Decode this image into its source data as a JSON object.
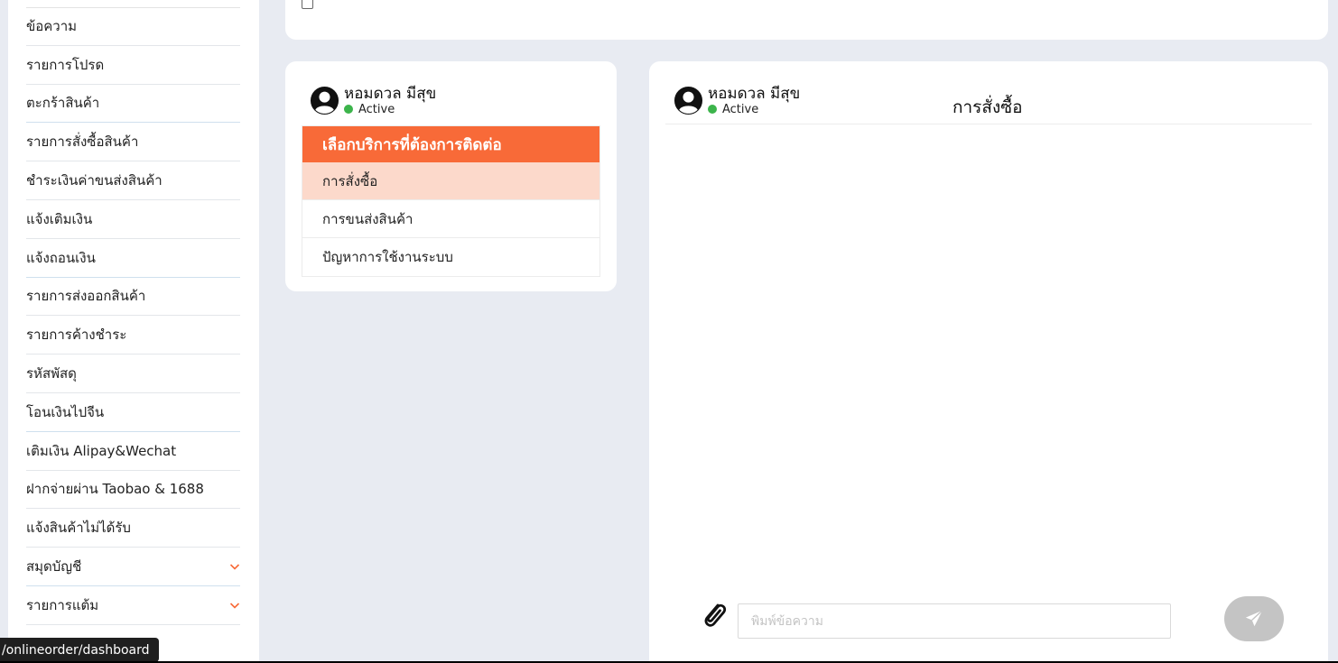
{
  "sidebar": {
    "items": [
      {
        "label": "ข้อความ",
        "expandable": false
      },
      {
        "label": "รายการโปรด",
        "expandable": false
      },
      {
        "label": "ตะกร้าสินค้า",
        "expandable": false
      },
      {
        "label": "รายการสั่งซื้อสินค้า",
        "expandable": false
      },
      {
        "label": "ชำระเงินค่าขนส่งสินค้า",
        "expandable": false
      },
      {
        "label": "แจ้งเติมเงิน",
        "expandable": false
      },
      {
        "label": "แจ้งถอนเงิน",
        "expandable": false
      },
      {
        "label": "รายการส่งออกสินค้า",
        "expandable": false
      },
      {
        "label": "รายการค้างชำระ",
        "expandable": false
      },
      {
        "label": "รหัสพัสดุ",
        "expandable": false
      },
      {
        "label": "โอนเงินไปจีน",
        "expandable": false
      },
      {
        "label": "เติมเงิน Alipay&Wechat",
        "expandable": false
      },
      {
        "label": "ฝากจ่ายผ่าน Taobao & 1688",
        "expandable": false
      },
      {
        "label": "แจ้งสินค้าไม่ได้รับ",
        "expandable": false
      },
      {
        "label": "สมุดบัญชี",
        "expandable": true
      },
      {
        "label": "รายการแต้ม",
        "expandable": true
      }
    ]
  },
  "user": {
    "name": "หอมดวล มีสุข",
    "status": "Active",
    "status_color": "#3cb44b"
  },
  "service_menu": {
    "header": "เลือกบริการที่ต้องการติดต่อ",
    "items": [
      {
        "label": "การสั่งซื้อ",
        "active": true
      },
      {
        "label": "การขนส่งสินค้า",
        "active": false
      },
      {
        "label": "ปัญหาการใช้งานระบบ",
        "active": false
      }
    ]
  },
  "chat": {
    "title": "การสั่งซื้อ",
    "input_placeholder": "พิมพ์ข้อความ",
    "input_value": ""
  },
  "status_bar": {
    "url": "/onlineorder/dashboard"
  },
  "colors": {
    "accent": "#f86a38",
    "active_item_bg": "#fcd9cb",
    "send_button": "#c4c4c4",
    "background": "#e8ebf2"
  },
  "icons": {
    "avatar": "user-circle-icon",
    "attach": "paperclip-icon",
    "send": "paper-plane-icon",
    "expand": "chevron-down-icon"
  }
}
